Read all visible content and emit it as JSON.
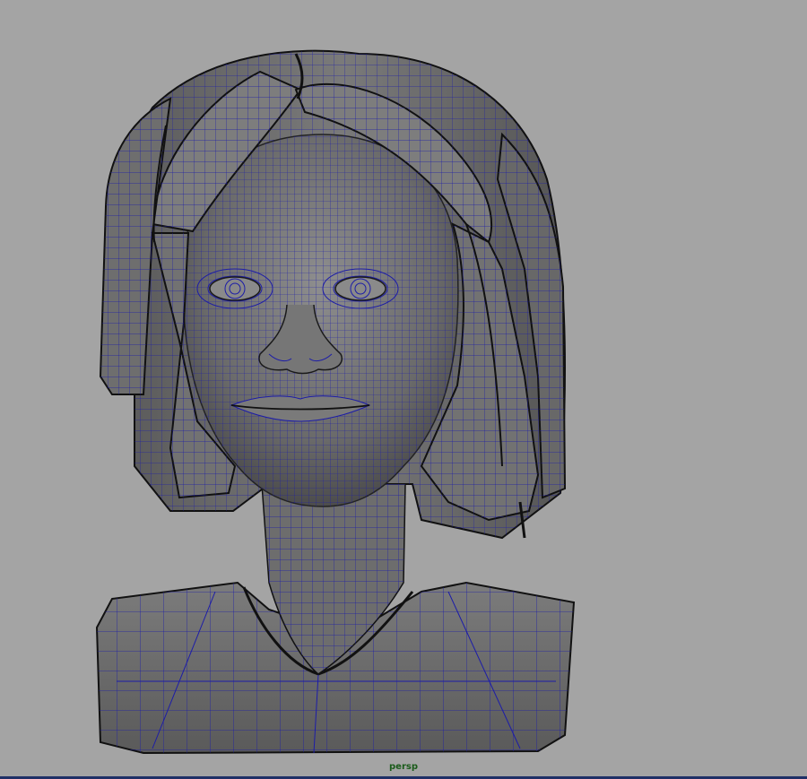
{
  "viewport": {
    "camera_label": "persp",
    "background_color": "#a4a4a4",
    "wireframe_color": "#1c1ca8",
    "shaded_color": "#6e6e6e",
    "edge_highlight_color": "#1f2f66"
  },
  "scene": {
    "object": "character-head-bust",
    "display_mode": "wireframe-on-shaded"
  }
}
